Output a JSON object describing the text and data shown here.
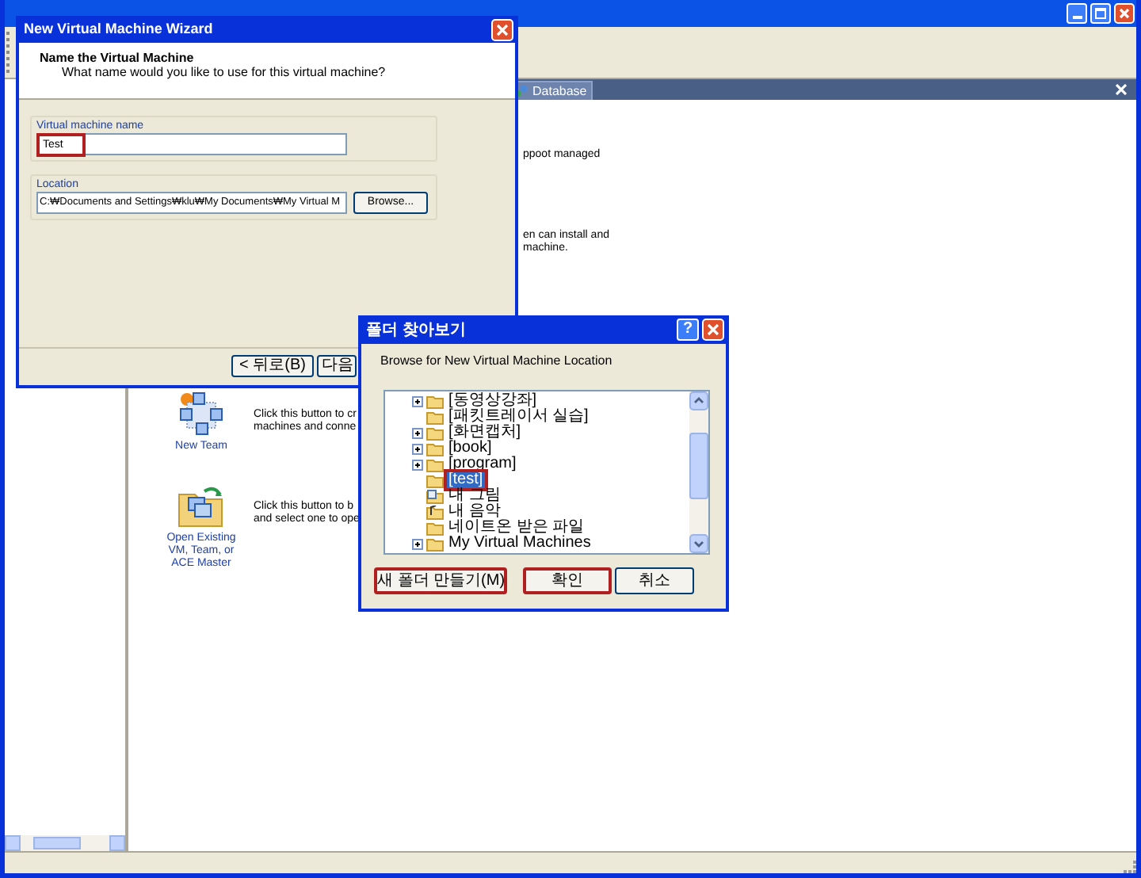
{
  "main_window": {
    "document_tab": {
      "label": "Database",
      "selected": true
    }
  },
  "home_page": {
    "partial_texts": [
      "ppoot managed",
      "en can install and",
      "machine."
    ],
    "actions": [
      {
        "kind": "team",
        "label": "New Team",
        "description": [
          "Click this button to cr",
          "machines and conne"
        ]
      },
      {
        "kind": "open",
        "label": "Open Existing VM, Team, or ACE Master",
        "description": [
          "Click this button to b",
          "and select one to ope"
        ]
      }
    ]
  },
  "wizard": {
    "title": "New Virtual Machine Wizard",
    "heading": "Name the Virtual Machine",
    "subheading": "What name would you like to use for this virtual machine?",
    "name_field": {
      "label": "Virtual machine name",
      "value": "Test",
      "highlighted": true
    },
    "location_field": {
      "label": "Location",
      "value": "C:₩Documents and Settings₩klu₩My Documents₩My Virtual M"
    },
    "browse_button": "Browse...",
    "buttons": [
      "< 뒤로(B)",
      "다음"
    ]
  },
  "folder_dialog": {
    "title": "폴더 찾아보기",
    "help": "?",
    "prompt": "Browse for New Virtual Machine Location",
    "tree": [
      {
        "label": "[동영상강좌]",
        "kind": "folder",
        "expandable": true,
        "selected": false,
        "highlighted": false
      },
      {
        "label": "[패킷트레이서 실습]",
        "kind": "folder",
        "expandable": false,
        "selected": false,
        "highlighted": false
      },
      {
        "label": "[화면캡처]",
        "kind": "folder",
        "expandable": true,
        "selected": false,
        "highlighted": false
      },
      {
        "label": "[book]",
        "kind": "folder",
        "expandable": true,
        "selected": false,
        "highlighted": false
      },
      {
        "label": "[program]",
        "kind": "folder",
        "expandable": true,
        "selected": false,
        "highlighted": false
      },
      {
        "label": "[test]",
        "kind": "folder",
        "expandable": false,
        "selected": true,
        "highlighted": true
      },
      {
        "label": "내 그림",
        "kind": "pictures",
        "expandable": false,
        "selected": false,
        "highlighted": false
      },
      {
        "label": "내 음악",
        "kind": "music",
        "expandable": false,
        "selected": false,
        "highlighted": false
      },
      {
        "label": "네이트온 받은 파일",
        "kind": "folder",
        "expandable": false,
        "selected": false,
        "highlighted": false
      },
      {
        "label": "My Virtual Machines",
        "kind": "folder",
        "expandable": true,
        "selected": false,
        "highlighted": false
      }
    ],
    "buttons": [
      {
        "label": "새 폴더 만들기(M)",
        "highlighted": true
      },
      {
        "label": "확인",
        "highlighted": true
      },
      {
        "label": "취소",
        "highlighted": false
      }
    ]
  }
}
